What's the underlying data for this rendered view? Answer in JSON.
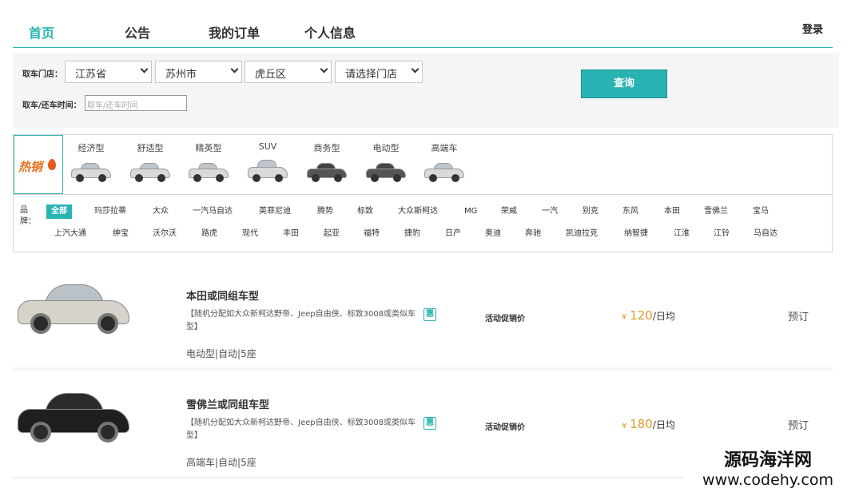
{
  "nav": {
    "items": [
      "首页",
      "公告",
      "我的订单",
      "个人信息"
    ],
    "login": "登录"
  },
  "search": {
    "store_label": "取车门店：",
    "province": "江苏省",
    "city": "苏州市",
    "district": "虎丘区",
    "store": "请选择门店",
    "time_label": "取车/还车时间：",
    "time_placeholder": "取车/还车时间",
    "button": "查询"
  },
  "filter": {
    "hot": "热销",
    "types": [
      "经济型",
      "舒适型",
      "精英型",
      "SUV",
      "商务型",
      "电动型",
      "高端车"
    ],
    "brand_label": "品牌：",
    "brands_row1": [
      "全部",
      "玛莎拉蒂",
      "大众",
      "一汽马自达",
      "英菲尼迪",
      "腾势",
      "标致",
      "大众斯柯达",
      "MG",
      "荣威",
      "一汽",
      "别克",
      "东风",
      "本田",
      "雪佛兰",
      "宝马"
    ],
    "brands_row2": [
      "上汽大通",
      "绅宝",
      "沃尔沃",
      "路虎",
      "现代",
      "丰田",
      "起亚",
      "福特",
      "捷豹",
      "日产",
      "奥迪",
      "奔驰",
      "凯迪拉克",
      "纳智捷",
      "江淮",
      "江铃",
      "马自达"
    ]
  },
  "list": [
    {
      "title": "本田或同组车型",
      "desc": "【随机分配如大众新柯达野帝、Jeep自由侠、标致3008或类似车型】",
      "promo_icon": "惠",
      "spec": "电动型|自动|5座",
      "promo_label": "活动促销价",
      "currency": "¥",
      "price": "120",
      "unit": "/日均",
      "book": "预订",
      "color": "#d6d3cb"
    },
    {
      "title": "雪佛兰或同组车型",
      "desc": "【随机分配如大众新柯达野帝、Jeep自由侠、标致3008或类似车型】",
      "promo_icon": "惠",
      "spec": "高端车|自动|5座",
      "promo_label": "活动促销价",
      "currency": "¥",
      "price": "180",
      "unit": "/日均",
      "book": "预订",
      "color": "#1f1f1f"
    }
  ],
  "watermark": {
    "line1": "源码海洋网",
    "line2": "www.codehy.com"
  },
  "colors": {
    "accent": "#2ab3b3",
    "price": "#e09b2c"
  }
}
